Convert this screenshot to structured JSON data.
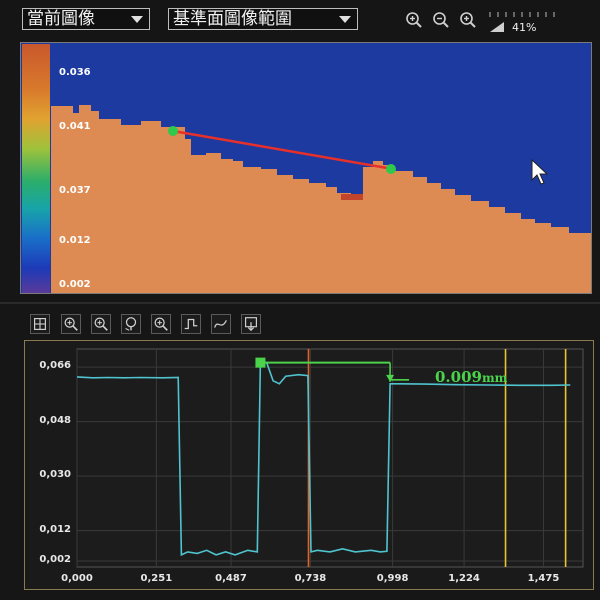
{
  "toolbar": {
    "image_select": "當前圖像",
    "range_select": "基準面圖像範圍",
    "zoom_percent": "41%"
  },
  "viewer": {
    "colorbar_labels": [
      "0.036",
      "0.041",
      "0.037",
      "0.012",
      "0.002"
    ]
  },
  "chart_data": {
    "type": "line",
    "title": "",
    "xlabel": "",
    "ylabel": "",
    "x_ticks": [
      "0,000",
      "0,251",
      "0,487",
      "0,738",
      "0,998",
      "1,224",
      "1,475"
    ],
    "y_ticks": [
      "0,066",
      "0,048",
      "0,030",
      "0,012",
      "0,002"
    ],
    "xlim": [
      0,
      1.6
    ],
    "ylim": [
      0,
      0.072
    ],
    "series": [
      {
        "color": "#4fc4cf",
        "points": [
          [
            0.0,
            0.0628
          ],
          [
            0.05,
            0.0625
          ],
          [
            0.1,
            0.0626
          ],
          [
            0.15,
            0.0625
          ],
          [
            0.2,
            0.0626
          ],
          [
            0.27,
            0.0625
          ],
          [
            0.32,
            0.0626
          ],
          [
            0.33,
            0.004
          ],
          [
            0.35,
            0.005
          ],
          [
            0.38,
            0.0045
          ],
          [
            0.41,
            0.0055
          ],
          [
            0.44,
            0.004
          ],
          [
            0.47,
            0.005
          ],
          [
            0.5,
            0.004
          ],
          [
            0.54,
            0.0055
          ],
          [
            0.57,
            0.005
          ],
          [
            0.58,
            0.068
          ],
          [
            0.6,
            0.0675
          ],
          [
            0.62,
            0.0615
          ],
          [
            0.64,
            0.0605
          ],
          [
            0.66,
            0.063
          ],
          [
            0.7,
            0.0635
          ],
          [
            0.73,
            0.0632
          ],
          [
            0.74,
            0.005
          ],
          [
            0.76,
            0.0055
          ],
          [
            0.8,
            0.005
          ],
          [
            0.84,
            0.006
          ],
          [
            0.88,
            0.005
          ],
          [
            0.93,
            0.0055
          ],
          [
            0.96,
            0.005
          ],
          [
            0.98,
            0.0052
          ],
          [
            0.99,
            0.0605
          ],
          [
            1.02,
            0.0605
          ],
          [
            1.1,
            0.0604
          ],
          [
            1.2,
            0.0602
          ],
          [
            1.3,
            0.0601
          ],
          [
            1.4,
            0.06
          ],
          [
            1.5,
            0.06
          ],
          [
            1.56,
            0.0601
          ]
        ]
      }
    ],
    "cursors": [
      {
        "x": 0.732,
        "color": "#e0632a"
      },
      {
        "x": 1.355,
        "color": "#e8c530"
      },
      {
        "x": 1.545,
        "color": "#e8c530"
      }
    ],
    "annotation": {
      "value": "0.009",
      "unit": "mm",
      "color": "#4bd34b"
    },
    "grid": true
  }
}
